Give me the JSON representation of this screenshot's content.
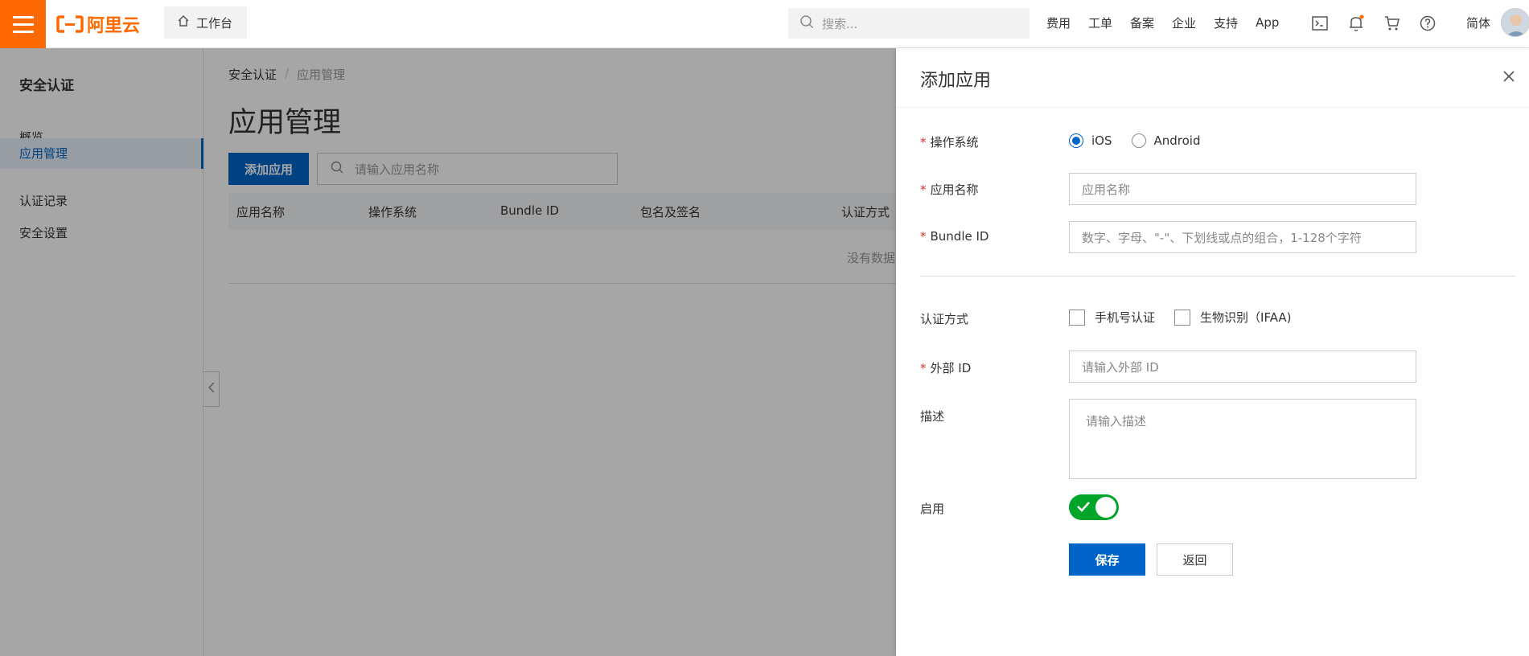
{
  "topbar": {
    "logo_text": "阿里云",
    "workbench_label": "工作台",
    "search_placeholder": "搜索...",
    "nav": [
      "费用",
      "工单",
      "备案",
      "企业",
      "支持",
      "App"
    ],
    "lang_label": "简体",
    "brand_color": "#ff6a00",
    "icons": [
      "terminal-icon",
      "bell-icon",
      "cart-icon",
      "help-icon"
    ]
  },
  "sidebar": {
    "title": "安全认证",
    "items": [
      {
        "label": "概览",
        "active": false
      },
      {
        "label": "应用管理",
        "active": true
      },
      {
        "label": "认证记录",
        "active": false
      },
      {
        "label": "安全设置",
        "active": false
      }
    ]
  },
  "main": {
    "breadcrumb": [
      "安全认证",
      "应用管理"
    ],
    "title": "应用管理",
    "add_button": "添加应用",
    "search_placeholder": "请输入应用名称",
    "columns": [
      "应用名称",
      "操作系统",
      "Bundle ID",
      "包名及签名",
      "认证方式"
    ],
    "empty_text": "没有数据"
  },
  "drawer": {
    "title": "添加应用",
    "os_label": "操作系统",
    "os_options": [
      {
        "label": "iOS",
        "checked": true
      },
      {
        "label": "Android",
        "checked": false
      }
    ],
    "app_name_label": "应用名称",
    "app_name_placeholder": "应用名称",
    "bundle_id_label": "Bundle ID",
    "bundle_id_placeholder": "数字、字母、\"-\"、下划线或点的组合，1-128个字符",
    "auth_method_label": "认证方式",
    "auth_methods": [
      {
        "label": "手机号认证",
        "checked": false
      },
      {
        "label": "生物识别（IFAA)",
        "checked": false
      }
    ],
    "external_id_label": "外部 ID",
    "external_id_placeholder": "请输入外部 ID",
    "description_label": "描述",
    "description_placeholder": "请输入描述",
    "enable_label": "启用",
    "enabled": true,
    "save_button": "保存",
    "back_button": "返回",
    "primary_color": "#0064c8",
    "toggle_color": "#00a52a"
  }
}
